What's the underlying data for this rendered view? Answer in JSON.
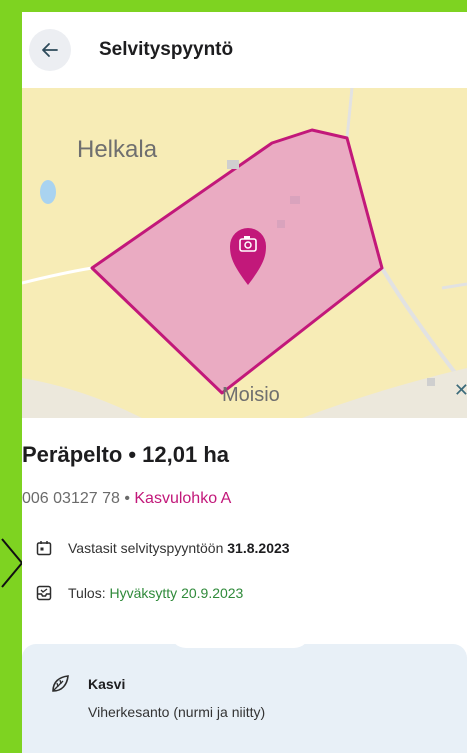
{
  "appbar": {
    "title": "Selvityspyyntö"
  },
  "map": {
    "label_north": "Helkala",
    "label_south": "Moisio",
    "area_color": "#e8a0c4",
    "border_color": "#c2187a"
  },
  "field": {
    "name_area": "Peräpelto • 12,01 ha",
    "id": "006 03127 78",
    "separator": " • ",
    "block": "Kasvulohko A"
  },
  "status": {
    "answered_text": "Vastasit selvityspyyntöön",
    "answered_date": "31.8.2023",
    "result_label": "Tulos:",
    "result_value": "Hyväksytty 20.9.2023"
  },
  "crop": {
    "label": "Kasvi",
    "value": "Viherkesanto (nurmi ja niitty)"
  },
  "colors": {
    "accent": "#c2187a",
    "success": "#2f8a3a",
    "frame": "#7ed321"
  }
}
